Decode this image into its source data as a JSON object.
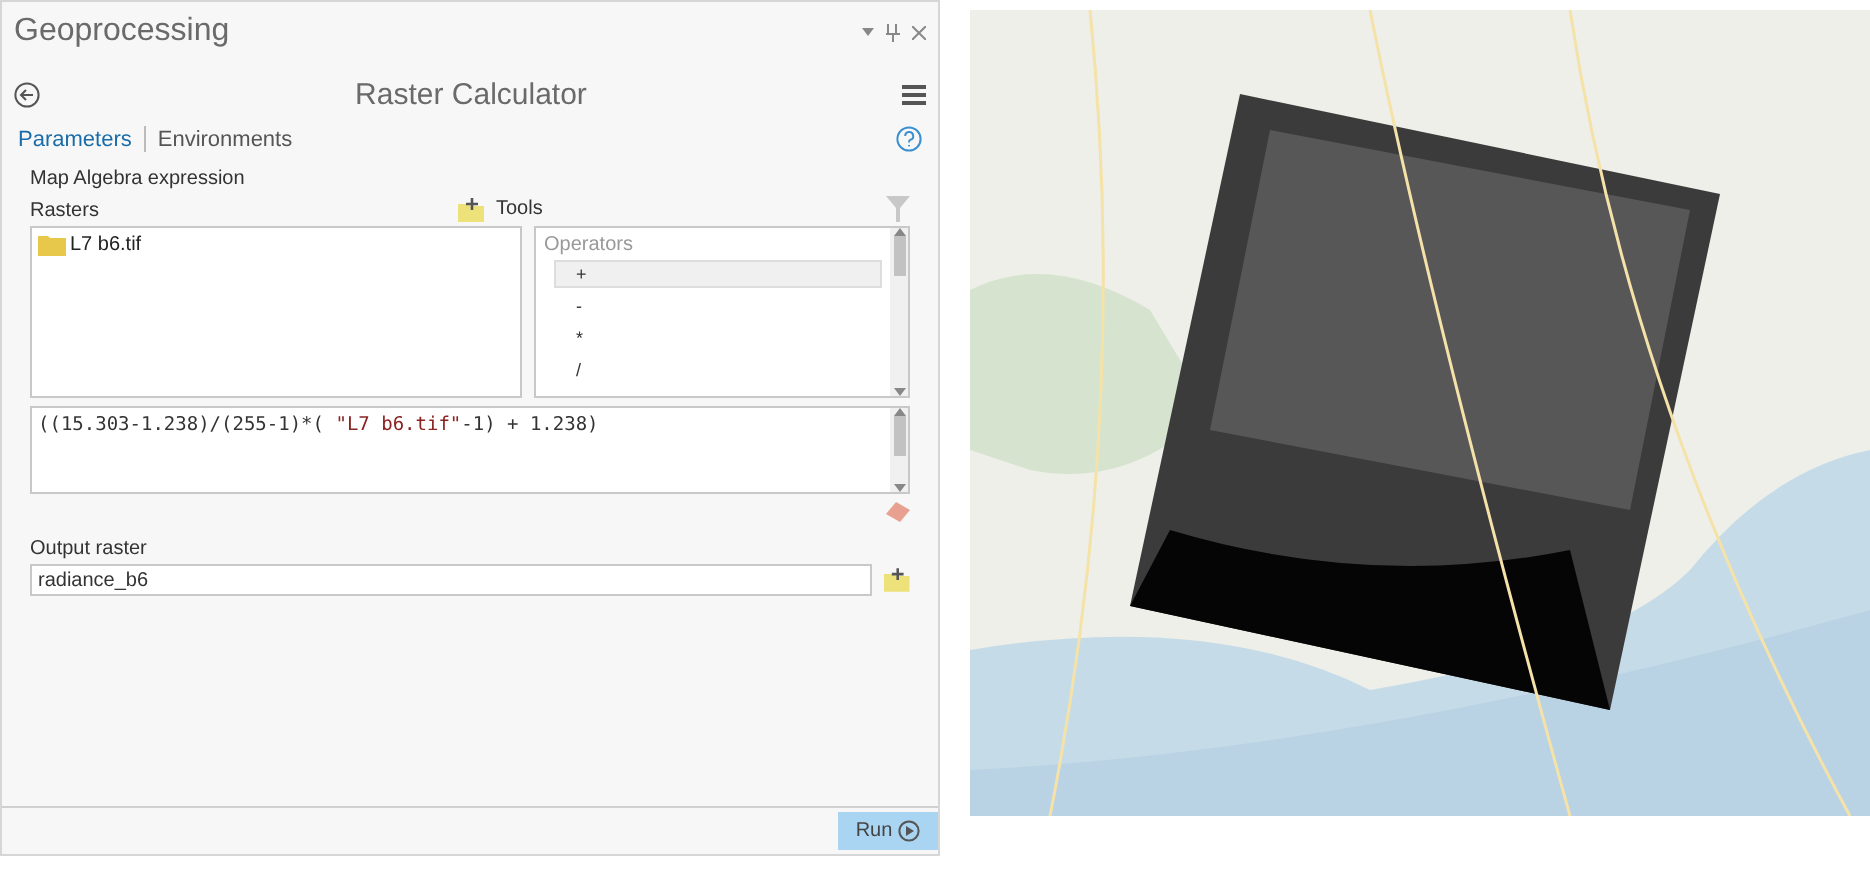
{
  "window": {
    "title": "Geoprocessing"
  },
  "tool": {
    "title": "Raster Calculator"
  },
  "tabs": [
    {
      "label": "Parameters",
      "selected": true
    },
    {
      "label": "Environments",
      "selected": false
    }
  ],
  "expression_section": {
    "label": "Map Algebra expression",
    "rasters_label": "Rasters",
    "tools_label": "Tools"
  },
  "rasters": [
    {
      "name": "L7 b6.tif"
    }
  ],
  "operators": {
    "heading": "Operators",
    "items": [
      {
        "symbol": "+",
        "selected": true
      },
      {
        "symbol": "-",
        "selected": false
      },
      {
        "symbol": "*",
        "selected": false
      },
      {
        "symbol": "/",
        "selected": false
      }
    ]
  },
  "expression": {
    "before": "((15.303-1.238)/(255-1)*( ",
    "raster": "\"L7 b6.tif\"",
    "after": "-1) + 1.238)"
  },
  "output": {
    "label": "Output raster",
    "value": "radiance_b6"
  },
  "run_button": "Run"
}
